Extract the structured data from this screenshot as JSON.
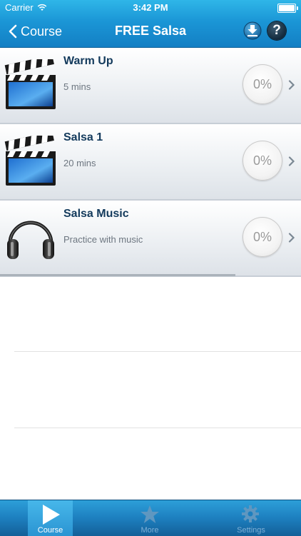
{
  "status_bar": {
    "carrier": "Carrier",
    "time": "3:42 PM"
  },
  "nav": {
    "back_label": "Course",
    "title": "FREE Salsa"
  },
  "icons": {
    "back": "chevron-left-icon",
    "download": "download-icon",
    "help": "help-icon",
    "video": "clapperboard-icon",
    "music": "headphones-icon",
    "play": "play-icon",
    "star": "star-icon",
    "settings": "gear-icon"
  },
  "items": [
    {
      "title": "Warm Up",
      "subtitle": "5 mins",
      "progress": "0%",
      "icon": "clapperboard-icon"
    },
    {
      "title": "Salsa 1",
      "subtitle": "20 mins",
      "progress": "0%",
      "icon": "clapperboard-icon"
    },
    {
      "title": "Salsa Music",
      "subtitle": "Practice with music",
      "progress": "0%",
      "icon": "headphones-icon"
    }
  ],
  "help_glyph": "?",
  "tabs": [
    {
      "label": "Course",
      "active": true
    },
    {
      "label": "More",
      "active": false
    },
    {
      "label": "Settings",
      "active": false
    }
  ],
  "colors": {
    "header": "#1b96d6",
    "title_text": "#133a5c",
    "tab_active": "#47b7ea"
  }
}
